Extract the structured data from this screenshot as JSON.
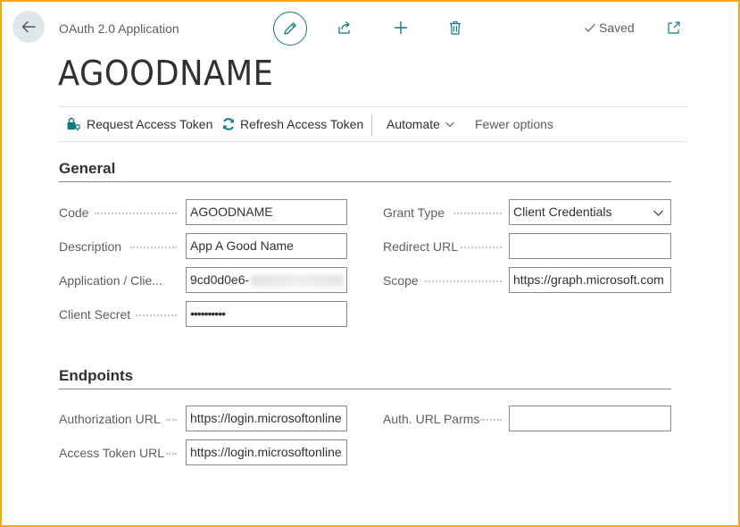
{
  "header": {
    "app_title": "OAuth 2.0 Application",
    "saved_label": "Saved",
    "record_title": "AGOODNAME",
    "icons": [
      "back-arrow-icon",
      "pencil-icon",
      "share-icon",
      "plus-icon",
      "trash-icon",
      "checkmark-icon",
      "open-new-window-icon"
    ],
    "accent_color": "#0f7a82"
  },
  "actions": {
    "request_token": "Request Access Token",
    "refresh_token": "Refresh Access Token",
    "automate": "Automate",
    "fewer_options": "Fewer options"
  },
  "general": {
    "title": "General",
    "code_label": "Code",
    "code_value": "AGOODNAME",
    "description_label": "Description",
    "description_value": "App A Good Name",
    "client_id_label": "Application / Clie...",
    "client_id_value": "9cd0d0e6-",
    "client_secret_label": "Client Secret",
    "client_secret_value": "••••••••••",
    "grant_type_label": "Grant Type",
    "grant_type_value": "Client Credentials",
    "redirect_url_label": "Redirect URL",
    "redirect_url_value": "",
    "scope_label": "Scope",
    "scope_value": "https://graph.microsoft.com"
  },
  "endpoints": {
    "title": "Endpoints",
    "auth_url_label": "Authorization URL",
    "auth_url_value": "https://login.microsoftonline",
    "access_token_url_label": "Access Token URL",
    "access_token_url_value": "https://login.microsoftonline",
    "auth_url_parms_label": "Auth. URL Parms",
    "auth_url_parms_value": ""
  }
}
